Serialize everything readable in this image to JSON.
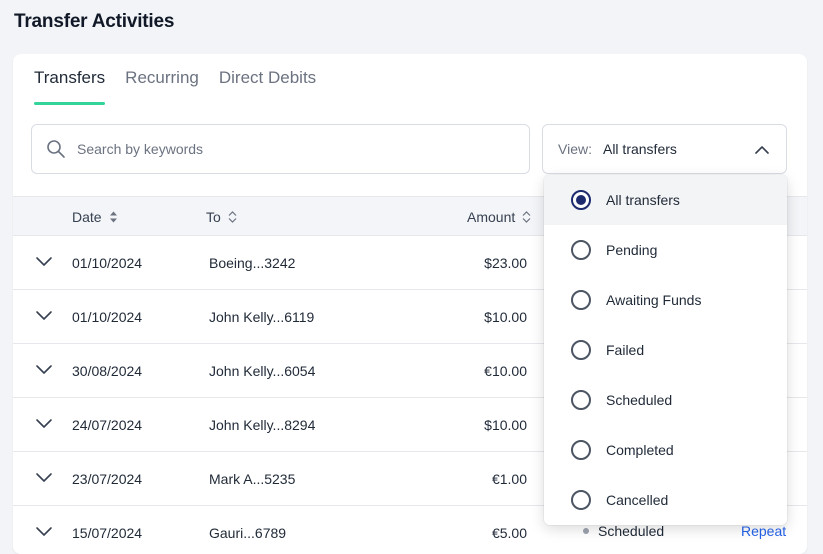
{
  "page": {
    "title": "Transfer Activities"
  },
  "tabs": [
    {
      "label": "Transfers",
      "active": true
    },
    {
      "label": "Recurring",
      "active": false
    },
    {
      "label": "Direct Debits",
      "active": false
    }
  ],
  "search": {
    "placeholder": "Search by keywords",
    "value": ""
  },
  "view": {
    "label": "View:",
    "value": "All transfers",
    "open": true
  },
  "table": {
    "columns": [
      "Date",
      "To",
      "Amount"
    ],
    "rows": [
      {
        "date": "01/10/2024",
        "to": "Boeing...3242",
        "amount": "$23.00"
      },
      {
        "date": "01/10/2024",
        "to": "John Kelly...6119",
        "amount": "$10.00"
      },
      {
        "date": "30/08/2024",
        "to": "John Kelly...6054",
        "amount": "€10.00"
      },
      {
        "date": "24/07/2024",
        "to": "John Kelly...8294",
        "amount": "$10.00"
      },
      {
        "date": "23/07/2024",
        "to": "Mark A...5235",
        "amount": "€1.00"
      },
      {
        "date": "15/07/2024",
        "to": "Gauri...6789",
        "amount": "€5.00",
        "status": "Scheduled",
        "action": "Repeat"
      }
    ]
  },
  "view_options": [
    {
      "label": "All transfers",
      "selected": true
    },
    {
      "label": "Pending",
      "selected": false
    },
    {
      "label": "Awaiting Funds",
      "selected": false
    },
    {
      "label": "Failed",
      "selected": false
    },
    {
      "label": "Scheduled",
      "selected": false
    },
    {
      "label": "Completed",
      "selected": false
    },
    {
      "label": "Cancelled",
      "selected": false
    }
  ],
  "colors": {
    "accent": "#34d399",
    "radio_selected": "#1e2a6e",
    "link": "#2563eb"
  }
}
